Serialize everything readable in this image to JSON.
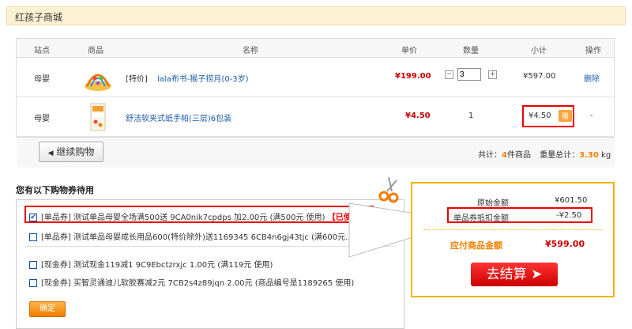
{
  "header": {
    "title": "红孩子商城"
  },
  "table": {
    "headers": [
      "站点",
      "商品",
      "名称",
      "单价",
      "数量",
      "小计",
      "操作"
    ],
    "rows": [
      {
        "station": "母婴",
        "tag": "[特价]",
        "name": "lala布书-猴子捞月(0-3岁)",
        "price": "¥199.00",
        "qty": "3",
        "subtotal": "¥597.00",
        "action": "删除",
        "qty_minus": "−",
        "qty_plus": "+"
      },
      {
        "station": "母婴",
        "name": "舒洁软夹式纸手帕(三层)6包装",
        "price": "¥4.50",
        "qty": "1",
        "subtotal": "¥4.50",
        "badge": "赠",
        "action": "-"
      }
    ]
  },
  "summary": {
    "continue_label": "继续购物",
    "total_prefix": "共计：",
    "count": "4",
    "count_suffix": "件商品",
    "weight_prefix": "重量总计：",
    "weight": "3.30",
    "weight_unit": "kg"
  },
  "coupons": {
    "title": "您有以下购物券待用",
    "items": [
      {
        "checked": true,
        "text": "[单品券]  测试单品母婴全场满500送  9CA0nik7cpdps  加2.00元  (满500元 使用)",
        "used": "【已使用】"
      },
      {
        "checked": false,
        "text": "[单品券]  测试单品母婴成长用品600(特价除外)送1169345  6CB4n6gj43tjc  (满600元..."
      },
      {
        "checked": false,
        "text": "[现金券]  测试现金119减1  9C9Ebctzrxjc  1.00元  (满119元 使用)"
      },
      {
        "checked": false,
        "text": "[现金券]  买智灵通迪儿软胶赛减2元  7CB2s4z89jqn  2.00元  (商品编号是1189265 使用)"
      }
    ],
    "confirm_label": "确定"
  },
  "panel": {
    "orig_label": "原始金额",
    "orig_value": "¥601.50",
    "deduct_label": "单品券抵扣金额",
    "deduct_value": "-¥2.50",
    "due_label": "应付商品金额",
    "due_value": "¥599.00",
    "pay_label": "去结算",
    "pay_arrow": "➤"
  },
  "colors": {
    "accent": "#f08000",
    "price": "#cc0000",
    "panel_border": "#f4b400",
    "header_bg": "#fbf1d3"
  }
}
